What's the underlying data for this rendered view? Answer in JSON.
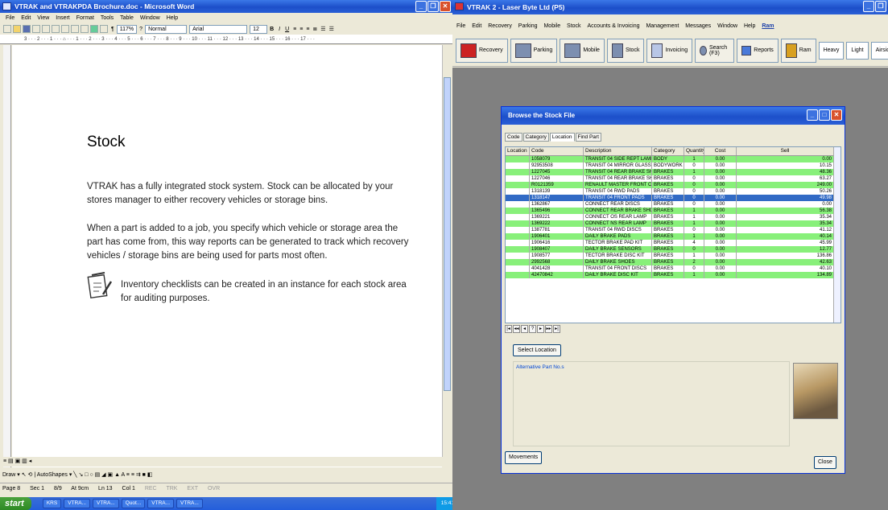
{
  "word": {
    "title": "VTRAK and VTRAKPDA Brochure.doc - Microsoft Word",
    "menu": [
      "File",
      "Edit",
      "View",
      "Insert",
      "Format",
      "Tools",
      "Table",
      "Window",
      "Help"
    ],
    "zoom": "117%",
    "style": "Normal",
    "font": "Arial",
    "size": "12",
    "heading": "Stock",
    "para1": "VTRAK has a fully integrated stock system. Stock can be allocated by your stores manager to either recovery vehicles or storage bins.",
    "para2": "When a part is added to a job, you specify which vehicle or storage area the part has come from, this way reports can be generated to track which recovery vehicles / storage bins are being used for parts most often.",
    "para3": "Inventory checklists can be created in an instance for each stock area for auditing purposes.",
    "draw_label": "Draw",
    "autoshapes_label": "AutoShapes",
    "status": {
      "page": "Page 8",
      "sec": "Sec 1",
      "pages": "8/9",
      "at": "At 9cm",
      "ln": "Ln 13",
      "col": "Col 1",
      "rec": "REC",
      "trk": "TRK",
      "ext": "EXT",
      "ovr": "OVR"
    }
  },
  "taskbar": {
    "start": "start",
    "items": [
      "KRS",
      "VTRA...",
      "VTRA...",
      "Quot...",
      "VTRA...",
      "VTRA..."
    ],
    "clock": "15:41"
  },
  "vtrak": {
    "title": "VTRAK 2 - Laser Byte Ltd (P5)",
    "menu": [
      "File",
      "Edit",
      "Recovery",
      "Parking",
      "Mobile",
      "Stock",
      "Accounts & Invoicing",
      "Management",
      "Messages",
      "Window",
      "Help",
      "Ram"
    ],
    "toolbar": [
      "Recovery",
      "Parking",
      "Mobile",
      "Stock",
      "Invoicing",
      "Search (F3)",
      "Reports",
      "Ram"
    ],
    "toolbar_text": [
      "Heavy",
      "Light",
      "Airside"
    ]
  },
  "dialog": {
    "title": "Browse the Stock File",
    "tabs": [
      "Code",
      "Category",
      "Location",
      "Find Part"
    ],
    "columns": [
      "Location",
      "Code",
      "Description",
      "Category",
      "Quantity",
      "Cost",
      "Sell"
    ],
    "rows": [
      [
        "",
        "1058079",
        "TRANSIT 04 SIDE REPT LAMP",
        "BODY",
        "1",
        "0.00",
        "0.00",
        "g"
      ],
      [
        "",
        "92953508",
        "TRANSIT 04 MIRROR GLASS",
        "BODYWORK",
        "0",
        "0.00",
        "10.15",
        ""
      ],
      [
        "",
        "1227045",
        "TRANSIT 04 REAR BRAKE SHOES 10c",
        "BRAKES",
        "1",
        "0.00",
        "48.36",
        "g"
      ],
      [
        "",
        "1227046",
        "TRANSIT 04 REAR BRAKE SHOES 11c",
        "BRAKES",
        "0",
        "0.00",
        "63.27",
        ""
      ],
      [
        "",
        "R0121359",
        "RENAULT MASTER FRONT CALIPER",
        "BRAKES",
        "0",
        "0.00",
        "249.00",
        "g"
      ],
      [
        "",
        "1318139",
        "TRANSIT 04 RWD PADS",
        "BRAKES",
        "0",
        "0.00",
        "50.26",
        ""
      ],
      [
        "",
        "1318147",
        "TRANSIT 04 FRONT PADS",
        "BRAKES",
        "0",
        "0.00",
        "49.98",
        "sel"
      ],
      [
        "",
        "1362867",
        "CONNECT REAR DISCS",
        "BRAKES",
        "0",
        "0.00",
        "0.00",
        ""
      ],
      [
        "",
        "1365496",
        "CONNECT REAR BRAKE SHOES",
        "BRAKES",
        "1",
        "0.00",
        "56.38",
        "g"
      ],
      [
        "",
        "1369221",
        "CONNECT OS REAR LAMP",
        "BRAKES",
        "1",
        "0.00",
        "35.34",
        ""
      ],
      [
        "",
        "1369222",
        "CONNECT NS REAR LAMP",
        "BRAKES",
        "1",
        "0.00",
        "35.34",
        "g"
      ],
      [
        "",
        "1387781",
        "TRANSIT 04 RWD DISCS",
        "BRAKES",
        "0",
        "0.00",
        "41.12",
        ""
      ],
      [
        "",
        "1906401",
        "DAILY BRAKE PADS",
        "BRAKES",
        "1",
        "0.00",
        "40.14",
        "g"
      ],
      [
        "",
        "1906416",
        "TECTOR BRAKE PAD KIT",
        "BRAKES",
        "4",
        "0.00",
        "45.99",
        ""
      ],
      [
        "",
        "1908407",
        "DAILY BRAKE SENSORS",
        "BRAKES",
        "0",
        "0.00",
        "12.77",
        "g"
      ],
      [
        "",
        "1908577",
        "TECTOR BRAKE DISC KIT",
        "BRAKES",
        "1",
        "0.00",
        "136.86",
        ""
      ],
      [
        "",
        "2992568",
        "DAILY BRAKE SHOES",
        "BRAKES",
        "2",
        "0.00",
        "42.63",
        "g"
      ],
      [
        "",
        "4041428",
        "TRANSIT 04 FRONT DISCS",
        "BRAKES",
        "0",
        "0.00",
        "40.10",
        ""
      ],
      [
        "",
        "42470842",
        "DAILY BRAKE DISC KIT",
        "BRAKES",
        "1",
        "0.00",
        "134.89",
        "g"
      ]
    ],
    "select_location": "Select Location",
    "alt_label": "Alternative Part No.s",
    "movements": "Movements",
    "close": "Close"
  }
}
